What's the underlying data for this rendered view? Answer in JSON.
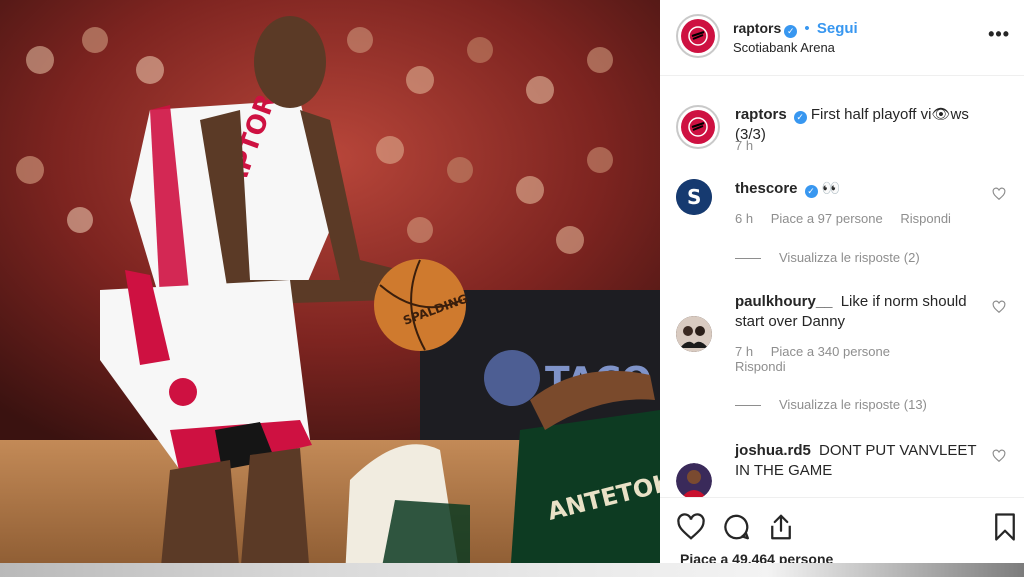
{
  "photo": {
    "jersey_text": "RAPTORS",
    "opponent_jersey_text": "ANTETOKOUNMPO",
    "ball_text": "SPALDING",
    "sign_text": "TACO"
  },
  "header": {
    "username": "raptors",
    "separator": "•",
    "follow_label": "Segui",
    "location": "Scotiabank Arena",
    "more_label": "•••"
  },
  "caption": {
    "username": "raptors",
    "text": "First half playoff vi👁ws (3/3)",
    "time": "7 h"
  },
  "comments": [
    {
      "username": "thescore",
      "text": "👀",
      "time": "6 h",
      "likes": "Piace a 97 persone",
      "reply": "Rispondi",
      "view_replies": "Visualizza le risposte (2)"
    },
    {
      "username": "paulkhoury__",
      "text": "Like if norm should start over Danny",
      "time": "7 h",
      "likes": "Piace a 340 persone",
      "reply": "Rispondi",
      "view_replies": "Visualizza le risposte (13)"
    },
    {
      "username": "joshua.rd5",
      "text": "DONT PUT VANVLEET IN THE GAME"
    }
  ],
  "actions": {
    "likes_text": "Piace a 49.464 persone"
  },
  "colors": {
    "accent": "#3897f0",
    "raptors_red": "#ce1141",
    "bucks_green": "#0d3b22"
  }
}
